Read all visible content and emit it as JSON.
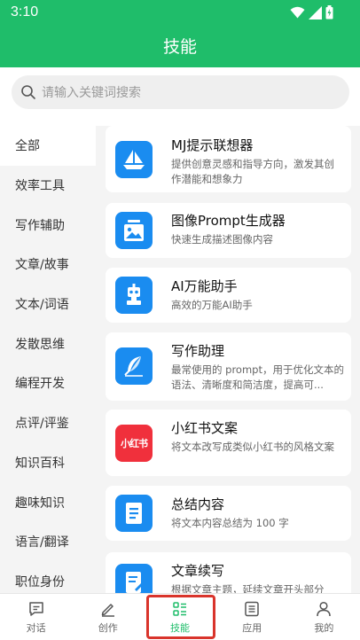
{
  "status": {
    "time": "3:10"
  },
  "header": {
    "title": "技能"
  },
  "search": {
    "placeholder": "请输入关键词搜索"
  },
  "categories": [
    {
      "label": "全部",
      "active": true
    },
    {
      "label": "效率工具"
    },
    {
      "label": "写作辅助"
    },
    {
      "label": "文章/故事"
    },
    {
      "label": "文本/词语"
    },
    {
      "label": "发散思维"
    },
    {
      "label": "编程开发"
    },
    {
      "label": "点评/评鉴"
    },
    {
      "label": "知识百科"
    },
    {
      "label": "趣味知识"
    },
    {
      "label": "语言/翻译"
    },
    {
      "label": "职位身份"
    }
  ],
  "skills": [
    {
      "title": "MJ提示联想器",
      "desc": "提供创意灵感和指导方向，激发其创作潜能和想象力",
      "icon": "sailboat-icon",
      "color": "#1a8cf0"
    },
    {
      "title": "图像Prompt生成器",
      "desc": "快速生成描述图像内容",
      "icon": "image-icon",
      "color": "#1a8cf0"
    },
    {
      "title": "AI万能助手",
      "desc": "高效的万能AI助手",
      "icon": "robot-icon",
      "color": "#1a8cf0"
    },
    {
      "title": "写作助理",
      "desc": "最常使用的 prompt，用于优化文本的语法、清晰度和简洁度，提高可...",
      "icon": "feather-icon",
      "color": "#1a8cf0"
    },
    {
      "title": "小红书文案",
      "desc": "将文本改写成类似小红书的风格文案",
      "icon": "xiaohongshu-icon",
      "icon_text": "小红书",
      "color": "#f0303c"
    },
    {
      "title": "总结内容",
      "desc": "将文本内容总结为 100 字",
      "icon": "document-icon",
      "color": "#1a8cf0"
    },
    {
      "title": "文章续写",
      "desc": "根据文章主题，延续文章开头部分",
      "icon": "edit-document-icon",
      "color": "#1a8cf0"
    }
  ],
  "bottom_nav": [
    {
      "label": "对话",
      "icon": "chat-icon"
    },
    {
      "label": "创作",
      "icon": "pen-icon"
    },
    {
      "label": "技能",
      "icon": "skills-grid-icon",
      "active": true
    },
    {
      "label": "应用",
      "icon": "apps-list-icon"
    },
    {
      "label": "我的",
      "icon": "person-icon"
    }
  ],
  "colors": {
    "brand": "#1fbd6a",
    "icon_blue": "#1a8cf0",
    "xhs_red": "#f0303c",
    "highlight": "#d9342b"
  }
}
